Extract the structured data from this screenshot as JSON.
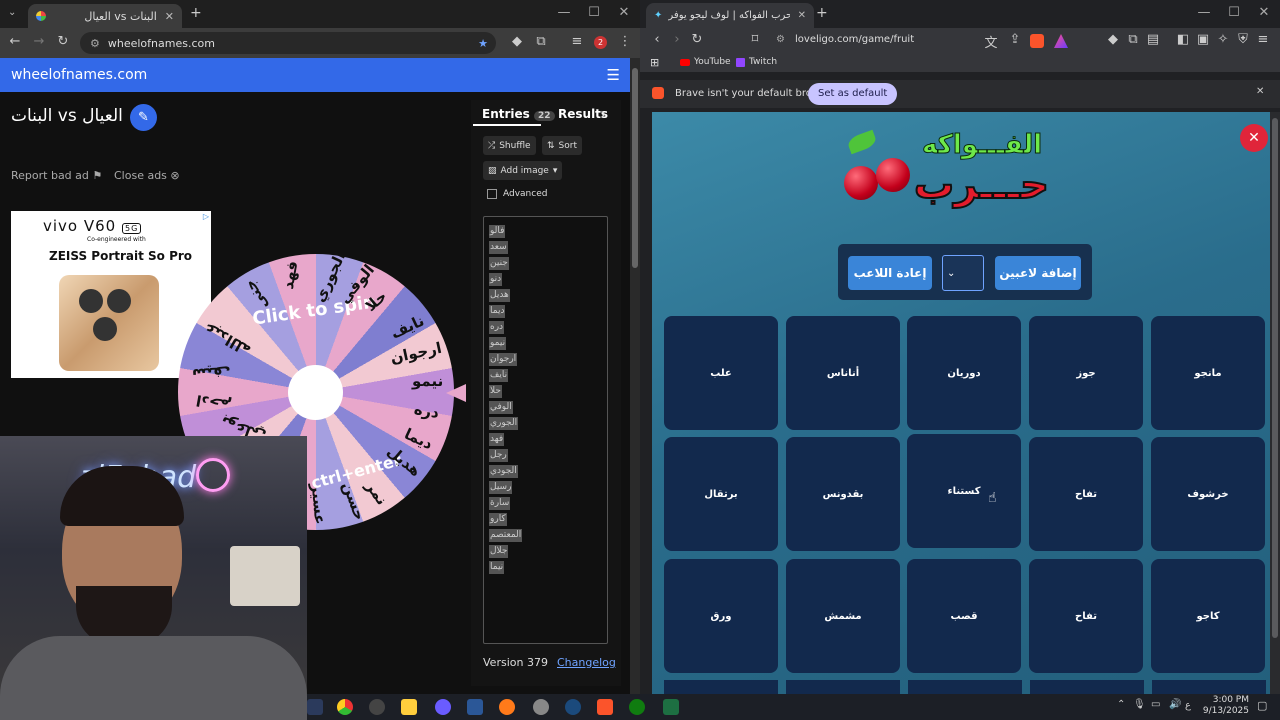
{
  "left_browser": {
    "tab_title": "العيال vs البنات",
    "url": "wheelofnames.com",
    "profile_badge": "2"
  },
  "won": {
    "brand": "wheelofnames.com",
    "wheel_title": "البنات vs العيال",
    "report_label": "Report bad ad",
    "close_ads_label": "Close ads",
    "ad": {
      "brand": "vivo V60",
      "badge": "5G",
      "coeng": "Co-engineered with",
      "headline": "ZEISS Portrait So Pro"
    },
    "wheel_text_1": "Click to spin",
    "wheel_text_2": "ctrl+enter",
    "wheel_names": [
      "فهد",
      "الجوري",
      "الوفي",
      "حلا",
      "نايف",
      "ارجوان",
      "نيمو",
      "دره",
      "ديما",
      "هديل",
      "نمر",
      "حسن",
      "عسير",
      "بوعلي",
      "ادحم",
      "سيف",
      "عبدالله",
      "جنى"
    ],
    "tabs": {
      "entries": "Entries",
      "entries_count": "22",
      "results": "Results"
    },
    "shuffle": "Shuffle",
    "sort": "Sort",
    "add_image": "Add image",
    "advanced": "Advanced",
    "entries": [
      "فالو",
      "سعد",
      "جنين",
      "دنو",
      "هديل",
      "ديما",
      "دره",
      "نيمو",
      "ارجوان",
      "نايف",
      "حلا",
      "الوفي",
      "الجوري",
      "فهد",
      "رجل",
      "الجودي",
      "رسيل",
      "سارة",
      "كارو",
      "المعتصم",
      "جلال",
      "نيما"
    ],
    "version": "Version 379",
    "changelog": "Changelog"
  },
  "cam": {
    "neon_text": "ziFahad"
  },
  "right_browser": {
    "tab_title": "لعبة حرب الفواكه | لوف ليجو يوفر",
    "url": "loveligo.com/game/fruit",
    "bookmarks": [
      "YouTube",
      "Twitch"
    ],
    "infobar_text": "Brave isn't your default browser",
    "set_default": "Set as default"
  },
  "game": {
    "logo_top": "الفـــواكه",
    "logo_bottom": "حـــرب",
    "reset_btn": "إعادة اللاعب",
    "add_btn": "إضافة لاعبين",
    "tiles": [
      "علب",
      "أناناس",
      "دوريان",
      "جوز",
      "مانجو",
      "برتقال",
      "بقدونس",
      "كستناء",
      "تفاح",
      "خرشوف",
      "ورق",
      "مشمش",
      "قصب",
      "تفاح",
      "كاجو"
    ]
  },
  "taskbar": {
    "time": "3:00 PM",
    "date": "9/13/2025",
    "lang": "ع"
  },
  "colors": {
    "won_blue": "#3369e8",
    "game_tile": "#12294d",
    "game_button": "#3a85d8",
    "close_red": "#e0253a"
  }
}
